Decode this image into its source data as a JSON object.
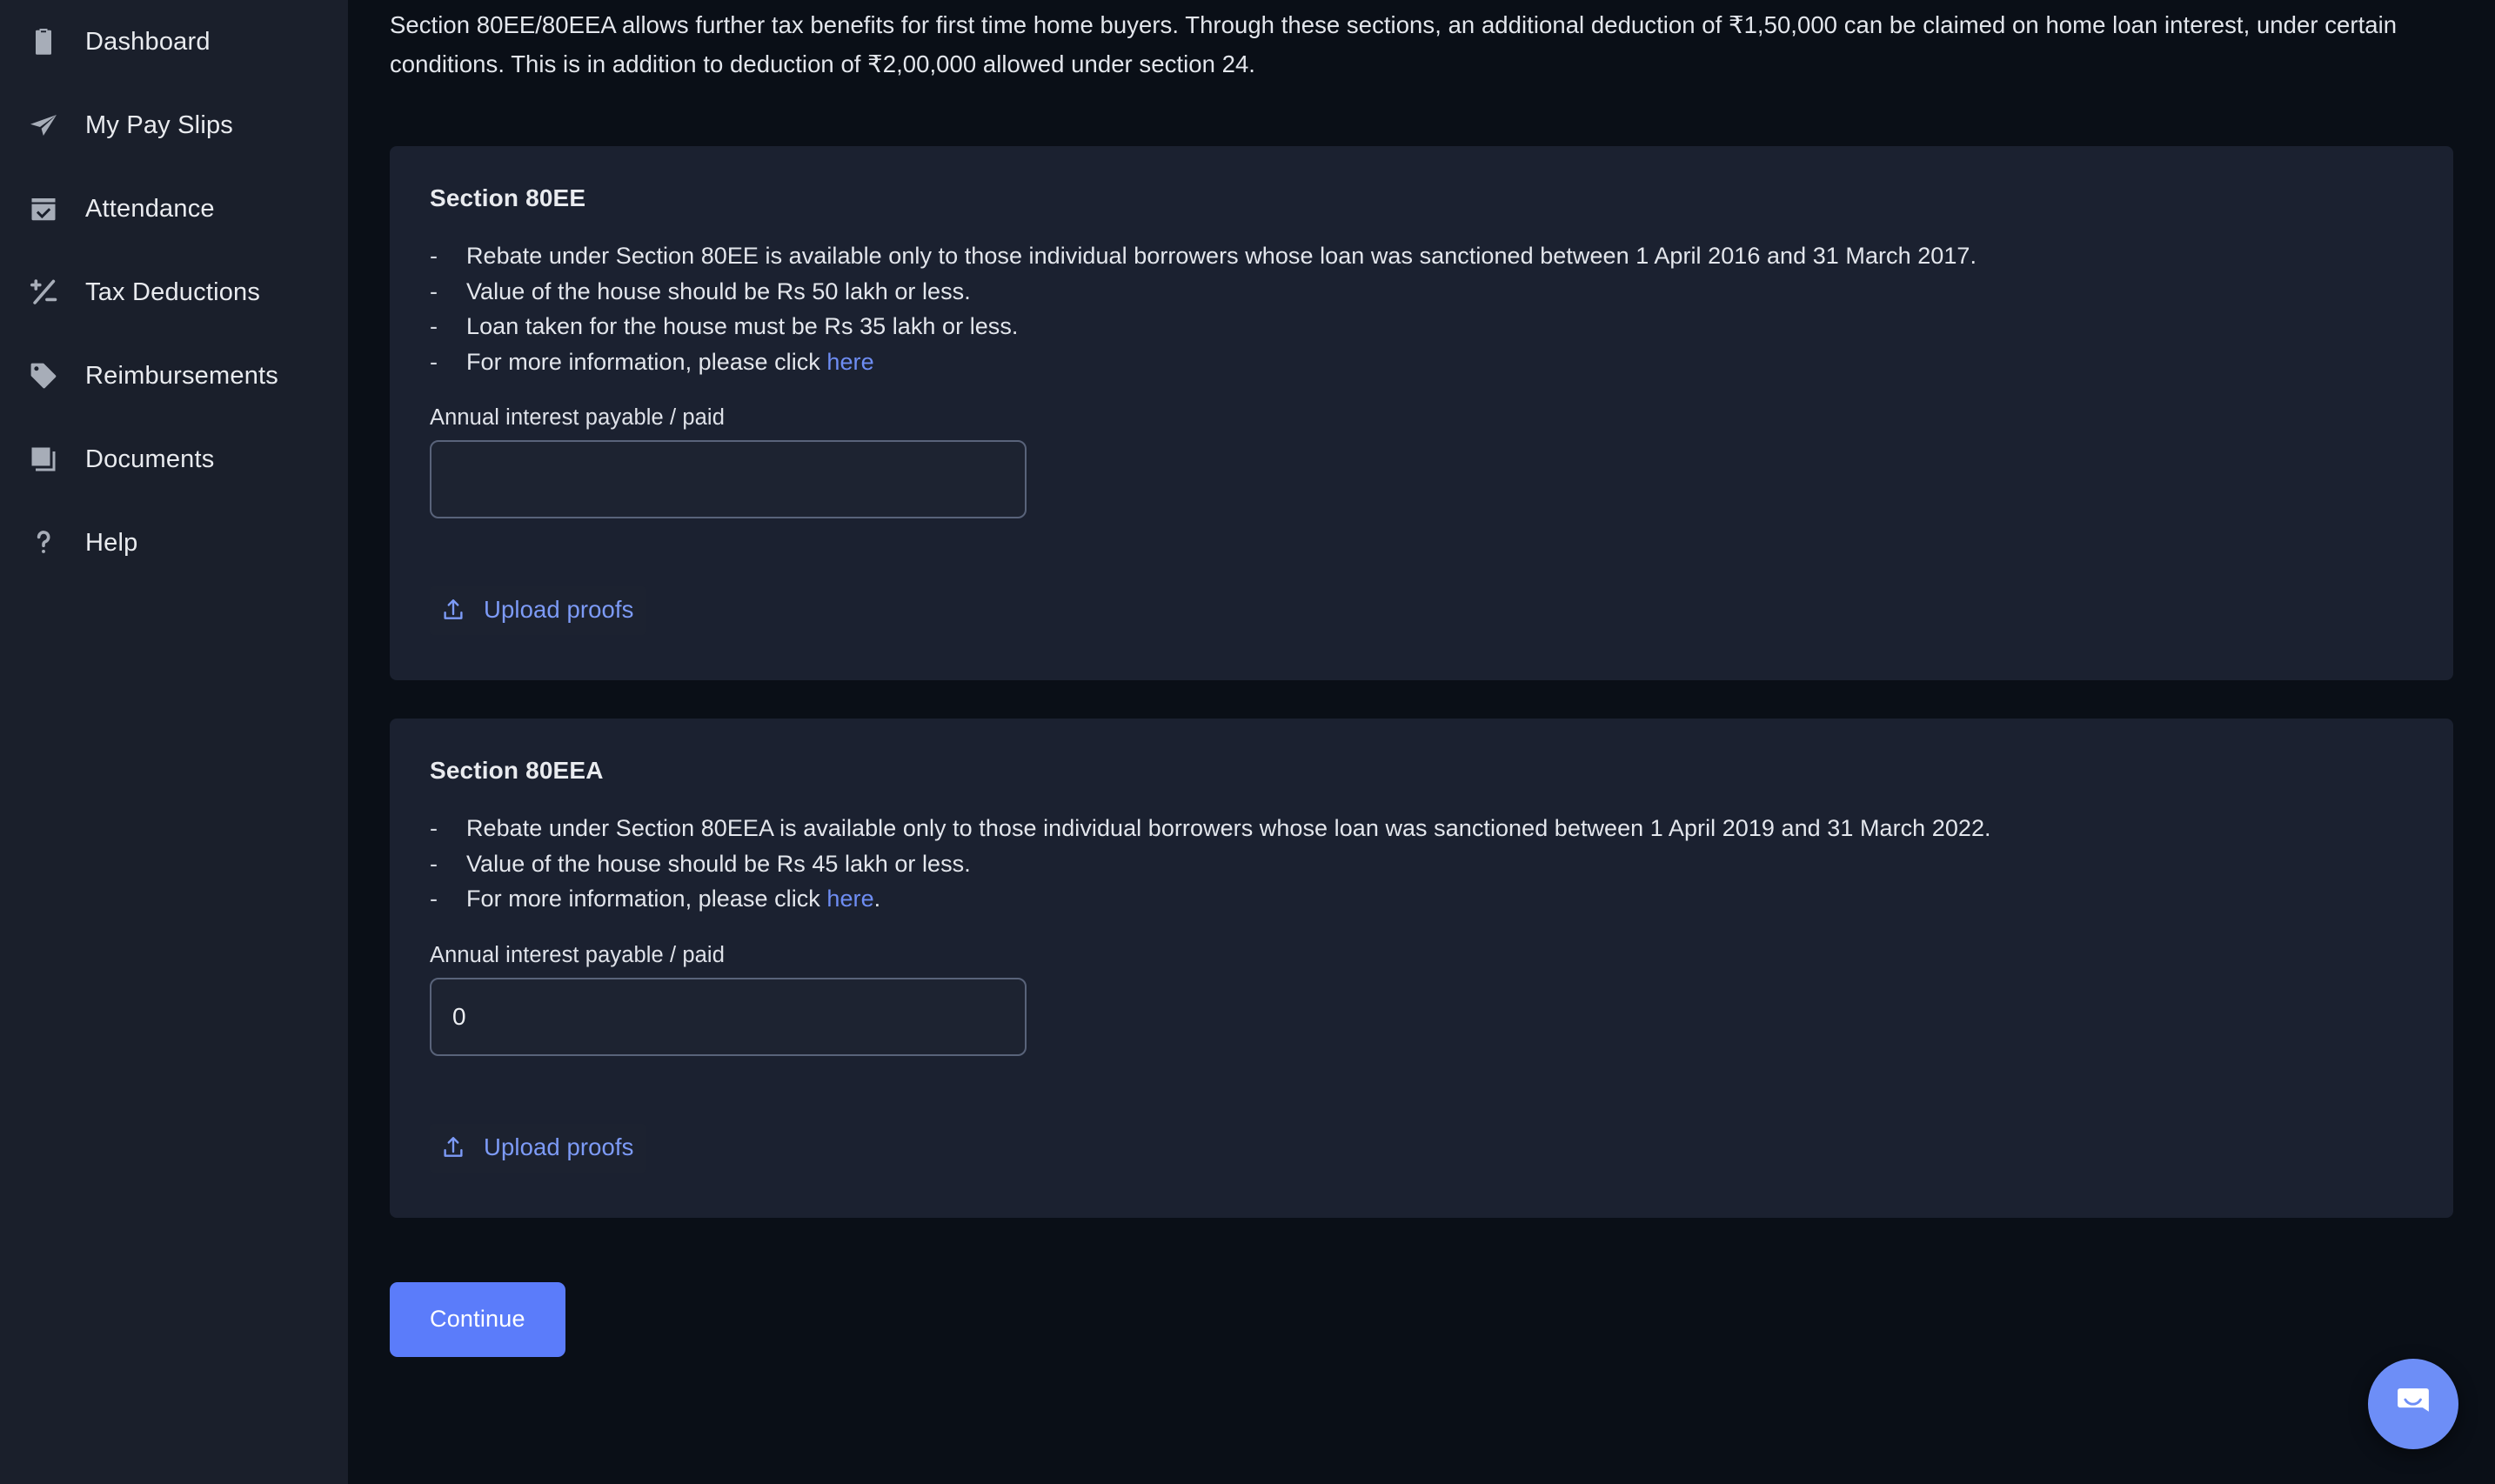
{
  "sidebar": {
    "items": [
      {
        "label": "Dashboard",
        "icon": "clipboard-icon"
      },
      {
        "label": "My Pay Slips",
        "icon": "paper-plane-icon"
      },
      {
        "label": "Attendance",
        "icon": "calendar-check-icon"
      },
      {
        "label": "Tax Deductions",
        "icon": "plus-minus-icon"
      },
      {
        "label": "Reimbursements",
        "icon": "tag-icon"
      },
      {
        "label": "Documents",
        "icon": "documents-icon"
      },
      {
        "label": "Help",
        "icon": "question-mark-icon"
      }
    ]
  },
  "main": {
    "intro": "Section 80EE/80EEA allows further tax benefits for first time home buyers. Through these sections, an additional deduction of ₹1,50,000 can be claimed on home loan interest, under certain conditions. This is in addition to deduction of ₹2,00,000 allowed under section 24.",
    "cards": [
      {
        "title": "Section 80EE",
        "bullets": [
          {
            "dash": "-",
            "text": "Rebate under Section 80EE is available only to those individual borrowers whose loan was sanctioned between 1 April 2016 and 31 March 2017."
          },
          {
            "dash": "-",
            "text": "Value of the house should be Rs 50 lakh or less."
          },
          {
            "dash": "-",
            "text": "Loan taken for the house must be Rs 35 lakh or less."
          },
          {
            "dash": "-",
            "text_before": "For more information, please click ",
            "link": "here",
            "text_after": ""
          }
        ],
        "field_label": "Annual interest payable / paid",
        "field_value": "",
        "field_placeholder": "",
        "upload_label": "Upload proofs"
      },
      {
        "title": "Section 80EEA",
        "bullets": [
          {
            "dash": "-",
            "text": "Rebate under Section 80EEA is available only to those individual borrowers whose loan was sanctioned between 1 April 2019 and 31 March 2022."
          },
          {
            "dash": "-",
            "text": "Value of the house should be Rs 45 lakh or less."
          },
          {
            "dash": "-",
            "text_before": "For more information, please click ",
            "link": "here",
            "text_after": "."
          }
        ],
        "field_label": "Annual interest payable / paid",
        "field_value": "0",
        "field_placeholder": "",
        "upload_label": "Upload proofs"
      }
    ],
    "continue_label": "Continue"
  },
  "colors": {
    "accent": "#5b7cfa",
    "link": "#7d9bf7",
    "sidebar_bg": "#1a1f2b",
    "page_bg": "#0a0f17",
    "card_bg": "#1b2130",
    "chat_bg": "#6d8ef7"
  }
}
